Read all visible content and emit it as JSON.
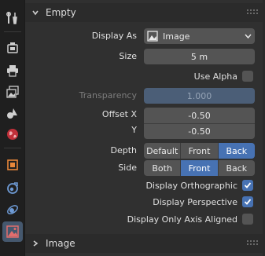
{
  "tabs": [
    {
      "name": "tab-tool",
      "icon": "wrench-screwdriver-icon",
      "active": false
    },
    {
      "name": "tab-render",
      "icon": "camera-back-icon",
      "active": false
    },
    {
      "name": "tab-output",
      "icon": "printer-icon",
      "active": false
    },
    {
      "name": "tab-view-layer",
      "icon": "image-stack-icon",
      "active": false
    },
    {
      "name": "tab-scene",
      "icon": "scene-icon",
      "active": false
    },
    {
      "name": "tab-world",
      "icon": "world-icon",
      "active": false
    },
    {
      "name": "tab-object",
      "icon": "object-square-icon",
      "active": false
    },
    {
      "name": "tab-constraints",
      "icon": "constraint-icon",
      "active": false
    },
    {
      "name": "tab-physics",
      "icon": "physics-orbit-icon",
      "active": false
    },
    {
      "name": "tab-object-data",
      "icon": "image-data-icon",
      "active": true
    }
  ],
  "colors": {
    "accent": "#4772b3",
    "panel": "#303030",
    "field": "#545454"
  },
  "empty_section": {
    "title": "Empty",
    "display_as": {
      "label": "Display As",
      "value": "Image"
    },
    "size": {
      "label": "Size",
      "value": "5 m"
    },
    "use_alpha": {
      "label": "Use Alpha",
      "checked": false
    },
    "transparency": {
      "label": "Transparency",
      "value": "1.000"
    },
    "offset_x": {
      "label": "Offset X",
      "value": "-0.50"
    },
    "offset_y": {
      "label": "Y",
      "value": "-0.50"
    },
    "depth": {
      "label": "Depth",
      "options": [
        "Default",
        "Front",
        "Back"
      ],
      "selected": "Back"
    },
    "side": {
      "label": "Side",
      "options": [
        "Both",
        "Front",
        "Back"
      ],
      "selected": "Front"
    },
    "display_orthographic": {
      "label": "Display Orthographic",
      "checked": true
    },
    "display_perspective": {
      "label": "Display Perspective",
      "checked": true
    },
    "display_only_axis_aligned": {
      "label": "Display Only Axis Aligned",
      "checked": false
    }
  },
  "image_section": {
    "title": "Image"
  }
}
